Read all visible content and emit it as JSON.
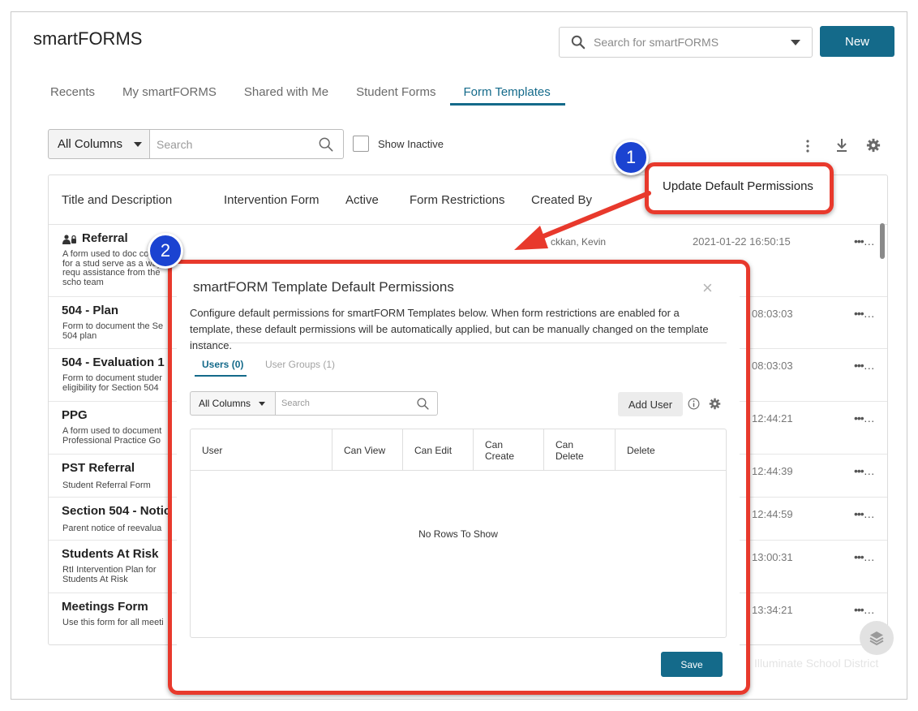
{
  "app": {
    "title": "smartFORMS",
    "search_placeholder": "Search for smartFORMS",
    "new_label": "New"
  },
  "tabs": [
    "Recents",
    "My smartFORMS",
    "Shared with Me",
    "Student Forms",
    "Form Templates"
  ],
  "active_tab": "Form Templates",
  "toolbar": {
    "columns_label": "All Columns",
    "search_placeholder": "Search",
    "show_inactive_label": "Show Inactive"
  },
  "grid": {
    "headers": [
      "Title and Description",
      "Intervention Form",
      "Active",
      "Form Restrictions",
      "Created By"
    ],
    "rows": [
      {
        "title": "Referral",
        "desc": "A form used to doc concerns for a stud serve as a way to requ assistance from the scho team",
        "created_by": "ckkan, Kevin",
        "date": "2021-01-22 16:50:15"
      },
      {
        "title": "504 - Plan",
        "desc": "Form to document the Se 504 plan",
        "date": "08:03:03"
      },
      {
        "title": "504 - Evaluation 1",
        "desc": "Form to document studer eligibility for Section 504",
        "date": "08:03:03"
      },
      {
        "title": "PPG",
        "desc": "A form used to document Professional Practice Go",
        "date": "12:44:21"
      },
      {
        "title": "PST Referral",
        "desc": "Student Referral Form",
        "date": "12:44:39"
      },
      {
        "title": "Section 504 - Notic",
        "desc": "Parent notice of reevalua",
        "date": "12:44:59"
      },
      {
        "title": "Students At Risk",
        "desc": "RtI Intervention Plan for Students At Risk",
        "date": "13:00:31"
      },
      {
        "title": "Meetings Form",
        "desc": "Use this form for all meeti",
        "date": "13:34:21"
      }
    ],
    "row_menu": "•••…"
  },
  "footer_faint": "Illuminate School District",
  "callouts": {
    "one": "1",
    "two": "2",
    "update_default_permissions": "Update Default Permissions"
  },
  "modal": {
    "title": "smartFORM Template Default Permissions",
    "close": "×",
    "description": "Configure default permissions for smartFORM Templates below. When form restrictions are enabled for a template, these default permissions will be automatically applied, but can be manually changed on the template instance.",
    "tab_users": "Users (0)",
    "tab_groups": "User Groups (1)",
    "columns_label": "All Columns",
    "search_placeholder": "Search",
    "add_user": "Add User",
    "headers": [
      "User",
      "Can View",
      "Can Edit",
      "Can Create",
      "Can Delete",
      "Delete"
    ],
    "empty": "No Rows To Show",
    "save": "Save"
  },
  "colors": {
    "primary": "#146a8a",
    "callout_red": "#e8392c",
    "badge_blue": "#1b43d1"
  }
}
